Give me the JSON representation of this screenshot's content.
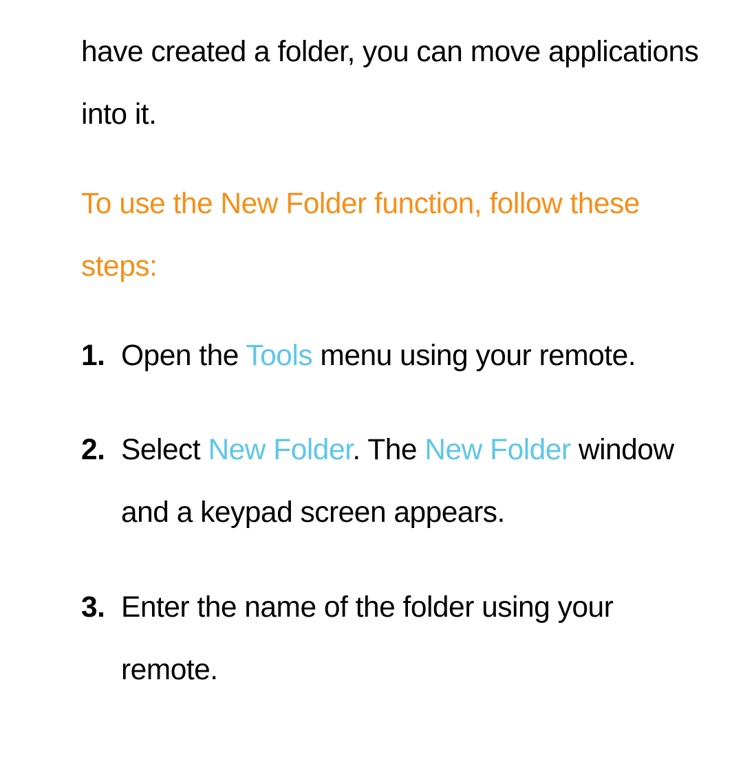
{
  "intro": "have created a folder, you can move applications into it.",
  "heading": "To use the New Folder function, follow these steps:",
  "steps": [
    {
      "number": "1.",
      "parts": [
        {
          "t": "Open the "
        },
        {
          "t": "Tools",
          "hl": true
        },
        {
          "t": " menu using your remote."
        }
      ]
    },
    {
      "number": "2.",
      "parts": [
        {
          "t": "Select "
        },
        {
          "t": "New Folder",
          "hl": true
        },
        {
          "t": ". The "
        },
        {
          "t": "New Folder",
          "hl": true
        },
        {
          "t": " window and a keypad screen appears."
        }
      ]
    },
    {
      "number": "3.",
      "parts": [
        {
          "t": "Enter the name of the folder using your remote."
        }
      ]
    }
  ]
}
